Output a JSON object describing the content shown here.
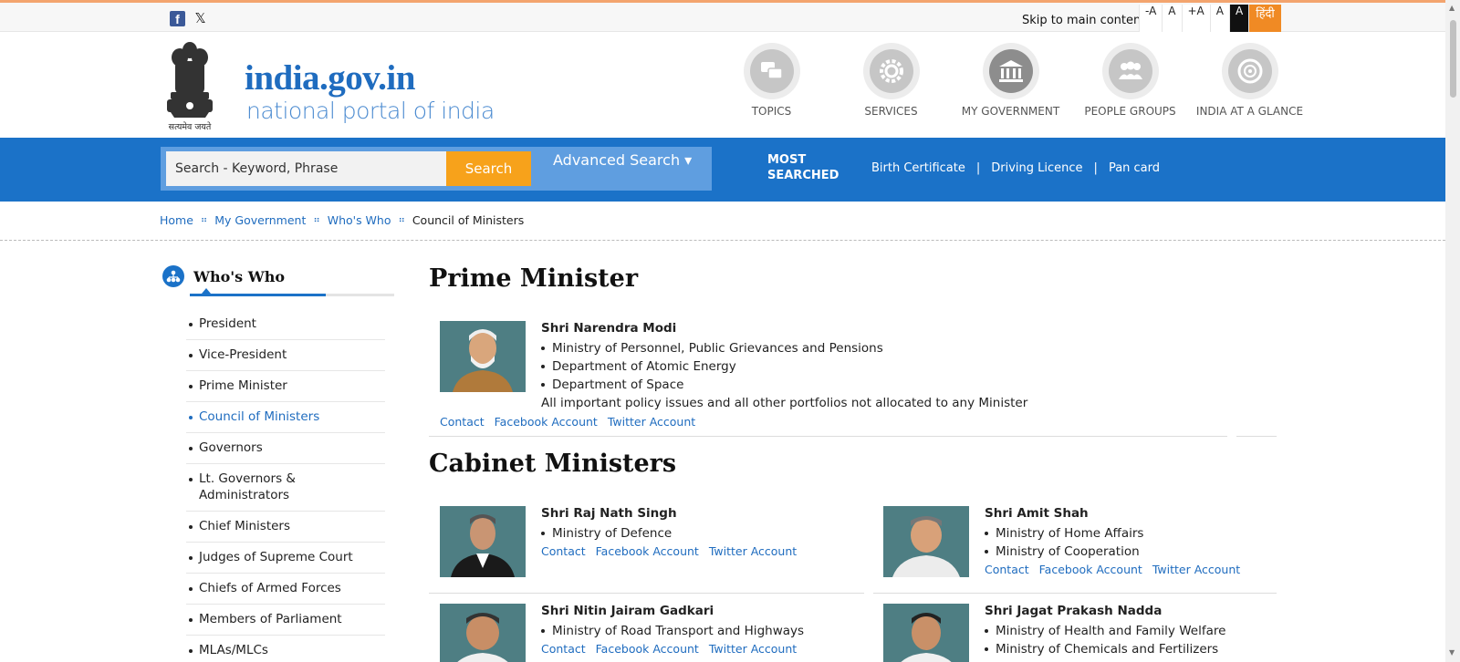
{
  "topbar": {
    "social": [
      "facebook-icon",
      "x-icon"
    ],
    "skip_link": "Skip to main content",
    "font_controls": [
      "-A",
      "A",
      "+A",
      "A",
      "A"
    ],
    "language": "हिंदी"
  },
  "header": {
    "emblem_caption": "सत्यमेव जयते",
    "logo_title": "india.gov.in",
    "logo_subtitle": "national portal of india",
    "nav": [
      {
        "label": "TOPICS",
        "icon": "chat-bubbles-icon"
      },
      {
        "label": "SERVICES",
        "icon": "gear-icon"
      },
      {
        "label": "MY GOVERNMENT",
        "icon": "government-building-icon"
      },
      {
        "label": "PEOPLE GROUPS",
        "icon": "people-group-icon"
      },
      {
        "label": "INDIA AT A GLANCE",
        "icon": "chakra-icon"
      }
    ]
  },
  "search": {
    "placeholder": "Search - Keyword, Phrase",
    "button": "Search",
    "advanced": "Advanced Search ▾",
    "most_searched_line1": "MOST",
    "most_searched_line2": "SEARCHED",
    "quick_links": [
      "Birth Certificate",
      "Driving Licence",
      "Pan card"
    ]
  },
  "breadcrumb": {
    "items": [
      "Home",
      "My Government",
      "Who's Who"
    ],
    "current": "Council of Ministers"
  },
  "sidebar": {
    "title": "Who's Who",
    "items": [
      "President",
      "Vice-President",
      "Prime Minister",
      "Council of Ministers",
      "Governors",
      "Lt. Governors & Administrators",
      "Chief Ministers",
      "Judges of Supreme Court",
      "Chiefs of Armed Forces",
      "Members of Parliament",
      "MLAs/MLCs"
    ],
    "active_index": 3
  },
  "main": {
    "pm_heading": "Prime Minister",
    "pm": {
      "name": "Shri Narendra Modi",
      "portfolios": [
        "Ministry of Personnel, Public Grievances and Pensions",
        "Department of Atomic Energy",
        "Department of Space"
      ],
      "note": "All important policy issues and all other portfolios not allocated to any Minister"
    },
    "cabinet_heading": "Cabinet Ministers",
    "ministers": [
      {
        "name": "Shri Raj Nath Singh",
        "portfolios": [
          "Ministry of Defence"
        ]
      },
      {
        "name": "Shri Amit Shah",
        "portfolios": [
          "Ministry of Home Affairs",
          "Ministry of Cooperation"
        ]
      },
      {
        "name": "Shri Nitin Jairam Gadkari",
        "portfolios": [
          "Ministry of Road Transport and Highways"
        ]
      },
      {
        "name": "Shri Jagat Prakash Nadda",
        "portfolios": [
          "Ministry of Health and Family Welfare",
          "Ministry of Chemicals and Fertilizers"
        ]
      }
    ],
    "link_labels": {
      "contact": "Contact",
      "facebook": "Facebook Account",
      "twitter": "Twitter Account"
    }
  },
  "colors": {
    "brand_blue": "#1b72c8",
    "search_orange": "#f7a21b",
    "hindi_orange": "#f08a24",
    "link_blue": "#1f6cbf"
  }
}
